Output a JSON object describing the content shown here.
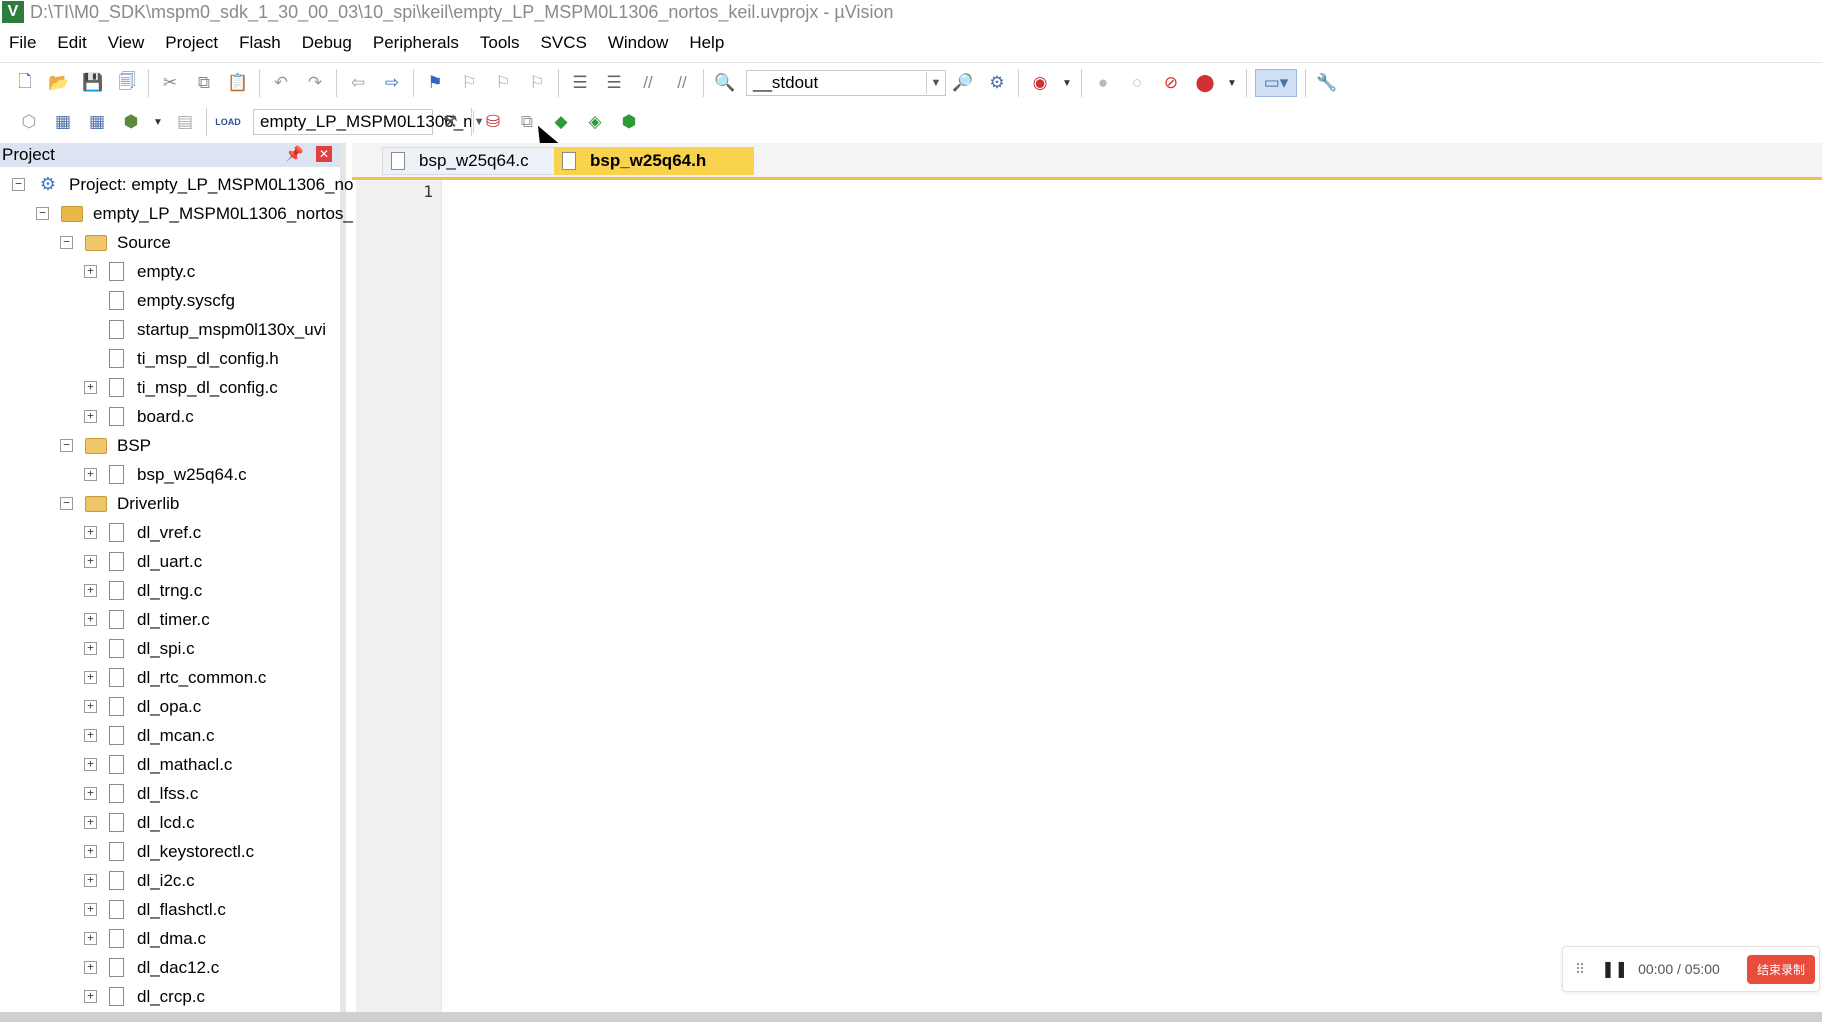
{
  "window": {
    "title": "D:\\TI\\M0_SDK\\mspm0_sdk_1_30_00_03\\10_spi\\keil\\empty_LP_MSPM0L1306_nortos_keil.uvprojx - µVision"
  },
  "menu": [
    "File",
    "Edit",
    "View",
    "Project",
    "Flash",
    "Debug",
    "Peripherals",
    "Tools",
    "SVCS",
    "Window",
    "Help"
  ],
  "toolbar": {
    "find_combo_value": "__stdout",
    "target_combo_value": "empty_LP_MSPM0L1306_n"
  },
  "project_panel": {
    "title": "Project",
    "tree": [
      {
        "label": "Project: empty_LP_MSPM0L1306_no",
        "level": 0,
        "kind": "project",
        "toggle": "-"
      },
      {
        "label": "empty_LP_MSPM0L1306_nortos_",
        "level": 1,
        "kind": "target",
        "toggle": "-"
      },
      {
        "label": "Source",
        "level": 2,
        "kind": "folder",
        "toggle": "-"
      },
      {
        "label": "empty.c",
        "level": 3,
        "kind": "file",
        "toggle": "+"
      },
      {
        "label": "empty.syscfg",
        "level": 3,
        "kind": "file",
        "toggle": ""
      },
      {
        "label": "startup_mspm0l130x_uvi",
        "level": 3,
        "kind": "file",
        "toggle": ""
      },
      {
        "label": "ti_msp_dl_config.h",
        "level": 3,
        "kind": "file",
        "toggle": ""
      },
      {
        "label": "ti_msp_dl_config.c",
        "level": 3,
        "kind": "file",
        "toggle": "+"
      },
      {
        "label": "board.c",
        "level": 3,
        "kind": "file",
        "toggle": "+"
      },
      {
        "label": "BSP",
        "level": 2,
        "kind": "folder",
        "toggle": "-"
      },
      {
        "label": "bsp_w25q64.c",
        "level": 3,
        "kind": "file",
        "toggle": "+"
      },
      {
        "label": "Driverlib",
        "level": 2,
        "kind": "folder",
        "toggle": "-"
      },
      {
        "label": "dl_vref.c",
        "level": 3,
        "kind": "file",
        "toggle": "+"
      },
      {
        "label": "dl_uart.c",
        "level": 3,
        "kind": "file",
        "toggle": "+"
      },
      {
        "label": "dl_trng.c",
        "level": 3,
        "kind": "file",
        "toggle": "+"
      },
      {
        "label": "dl_timer.c",
        "level": 3,
        "kind": "file",
        "toggle": "+"
      },
      {
        "label": "dl_spi.c",
        "level": 3,
        "kind": "file",
        "toggle": "+"
      },
      {
        "label": "dl_rtc_common.c",
        "level": 3,
        "kind": "file",
        "toggle": "+"
      },
      {
        "label": "dl_opa.c",
        "level": 3,
        "kind": "file",
        "toggle": "+"
      },
      {
        "label": "dl_mcan.c",
        "level": 3,
        "kind": "file",
        "toggle": "+"
      },
      {
        "label": "dl_mathacl.c",
        "level": 3,
        "kind": "file",
        "toggle": "+"
      },
      {
        "label": "dl_lfss.c",
        "level": 3,
        "kind": "file",
        "toggle": "+"
      },
      {
        "label": "dl_lcd.c",
        "level": 3,
        "kind": "file",
        "toggle": "+"
      },
      {
        "label": "dl_keystorectl.c",
        "level": 3,
        "kind": "file",
        "toggle": "+"
      },
      {
        "label": "dl_i2c.c",
        "level": 3,
        "kind": "file",
        "toggle": "+"
      },
      {
        "label": "dl_flashctl.c",
        "level": 3,
        "kind": "file",
        "toggle": "+"
      },
      {
        "label": "dl_dma.c",
        "level": 3,
        "kind": "file",
        "toggle": "+"
      },
      {
        "label": "dl_dac12.c",
        "level": 3,
        "kind": "file",
        "toggle": "+"
      },
      {
        "label": "dl_crcp.c",
        "level": 3,
        "kind": "file",
        "toggle": "+"
      }
    ]
  },
  "editor": {
    "tabs": [
      {
        "label": "bsp_w25q64.c",
        "active": false
      },
      {
        "label": "bsp_w25q64.h",
        "active": true
      }
    ],
    "line_numbers": [
      "1"
    ]
  },
  "recorder": {
    "time": "00:00 / 05:00",
    "stop_label": "结束录制"
  },
  "colors": {
    "active_tab": "#f9d24e",
    "panel_header": "#dbe4f0",
    "stop_button": "#e84c3d"
  }
}
